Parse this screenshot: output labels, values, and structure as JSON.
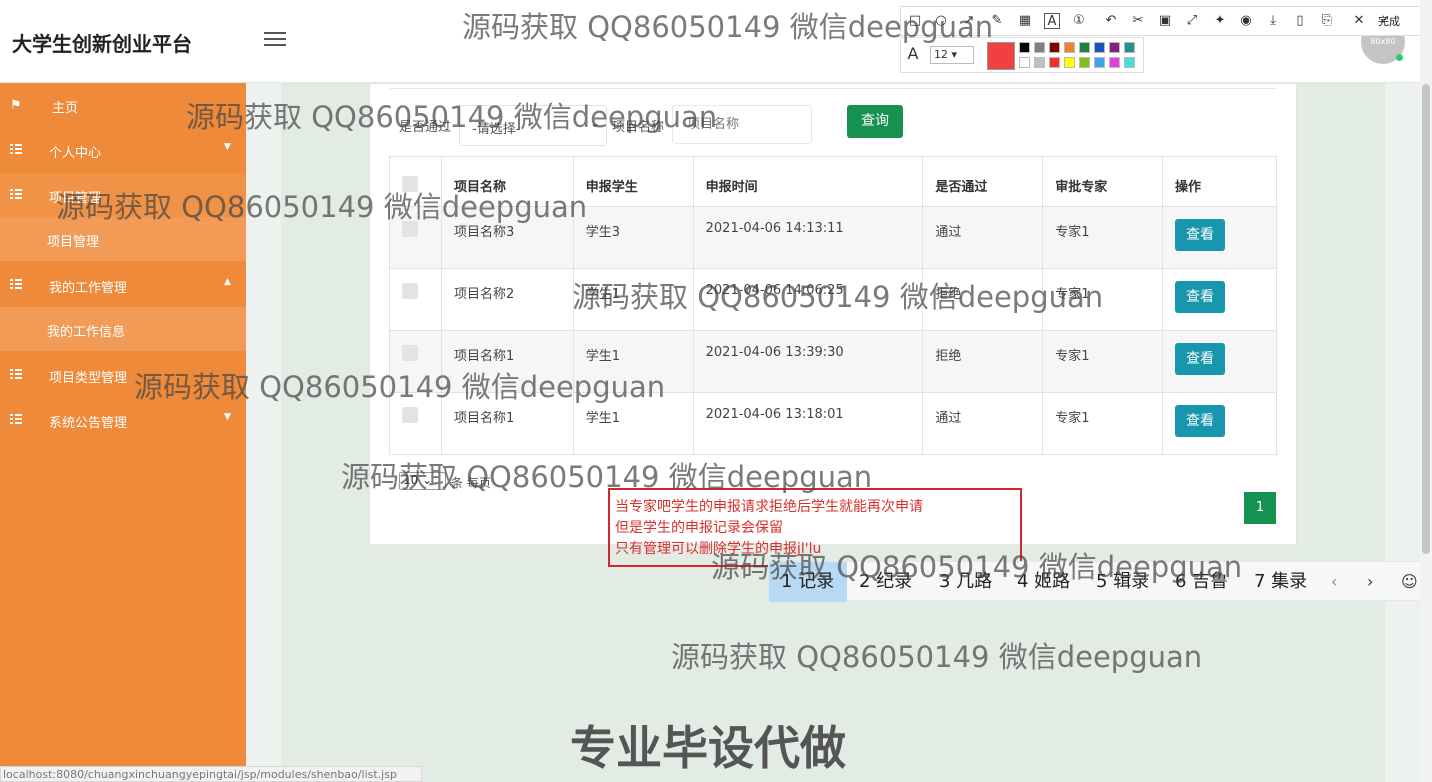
{
  "header": {
    "brand": "大学生创新创业平台",
    "avatar_text": "80x80"
  },
  "sidebar": {
    "items": [
      {
        "label": "主页",
        "icon": "flag-icon"
      },
      {
        "label": "个人中心",
        "icon": "grid-icon"
      },
      {
        "label": "项目管理",
        "icon": "grid-icon"
      },
      {
        "label": "项目管理",
        "icon": ""
      },
      {
        "label": "我的工作管理",
        "icon": "grid-icon"
      },
      {
        "label": "我的工作信息",
        "icon": ""
      },
      {
        "label": "项目类型管理",
        "icon": "grid-icon"
      },
      {
        "label": "系统公告管理",
        "icon": "grid-icon"
      }
    ]
  },
  "filters": {
    "passed_label": "是否通过",
    "passed_value": "-请选择-",
    "name_label": "项目名称",
    "name_placeholder": "项目名称",
    "search_label": "查询"
  },
  "table": {
    "headers": [
      "项目名称",
      "申报学生",
      "申报时间",
      "是否通过",
      "审批专家",
      "操作"
    ],
    "rows": [
      {
        "name": "项目名称3",
        "student": "学生3",
        "time": "2021-04-06 14:13:11",
        "passed": "通过",
        "expert": "专家1",
        "action": "查看"
      },
      {
        "name": "项目名称2",
        "student": "学生1",
        "time": "2021-04-06 14:06:25",
        "passed": "拒绝",
        "expert": "专家1",
        "action": "查看"
      },
      {
        "name": "项目名称1",
        "student": "学生1",
        "time": "2021-04-06 13:39:30",
        "passed": "拒绝",
        "expert": "专家1",
        "action": "查看"
      },
      {
        "name": "项目名称1",
        "student": "学生1",
        "time": "2021-04-06 13:18:01",
        "passed": "通过",
        "expert": "专家1",
        "action": "查看"
      }
    ]
  },
  "pagination": {
    "page_size": "10",
    "page_size_label": "条 每页",
    "current_page": "1"
  },
  "annotation": {
    "lines": [
      "当专家吧学生的申报请求拒绝后学生就能再次申请",
      "但是学生的申报记录会保留",
      "只有管理可以删除学生的申报jl'lu"
    ],
    "color": "#d9302e"
  },
  "ime": {
    "candidates": [
      "1 记录",
      "2 纪录",
      "3 几路",
      "4 姬路",
      "5 辑录",
      "6 吉鲁",
      "7 集录"
    ]
  },
  "screenshot_toolbar": {
    "done_label": "完成",
    "font_size": "12",
    "current_color": "#f04040",
    "palette": [
      "#000000",
      "#808080",
      "#800000",
      "#f08030",
      "#208040",
      "#2050c0",
      "#802080",
      "#209090",
      "#ffffff",
      "#c0c0c0",
      "#f03030",
      "#ffff00",
      "#80c020",
      "#40a0f0",
      "#e040e0",
      "#40e0e0"
    ]
  },
  "watermarks": [
    "源码获取 QQ86050149 微信deepguan",
    "专业毕设代做"
  ],
  "status_url": "localhost:8080/chuangxinchuangyepingtai/jsp/modules/shenbao/list.jsp"
}
